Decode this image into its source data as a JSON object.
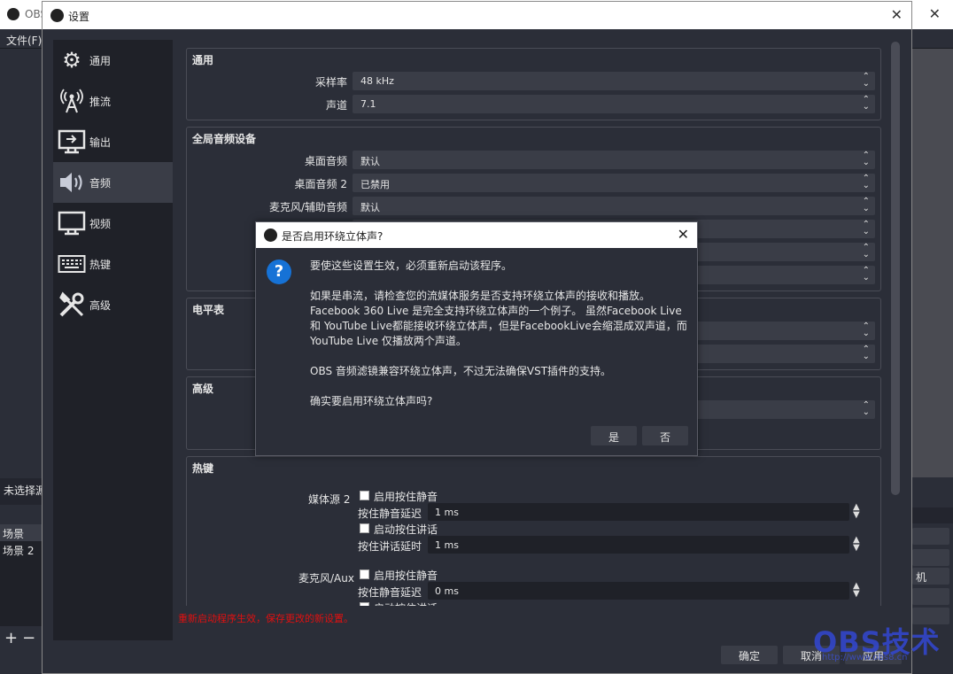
{
  "main_window": {
    "title": "OBS",
    "menu_file": "文件(F)",
    "scene_header": "未选择源",
    "scenes": [
      "场景",
      "场景 2"
    ],
    "add": "+",
    "remove": "−",
    "right_button": "机"
  },
  "settings": {
    "title": "设置",
    "nav": [
      {
        "label": "通用",
        "icon": "gear-icon"
      },
      {
        "label": "推流",
        "icon": "broadcast-icon"
      },
      {
        "label": "输出",
        "icon": "output-icon"
      },
      {
        "label": "音频",
        "icon": "speaker-icon"
      },
      {
        "label": "视频",
        "icon": "monitor-icon"
      },
      {
        "label": "热键",
        "icon": "keyboard-icon"
      },
      {
        "label": "高级",
        "icon": "tools-icon"
      }
    ],
    "active_nav": "音频",
    "general": {
      "title": "通用",
      "sample_rate_label": "采样率",
      "sample_rate_value": "48 kHz",
      "channels_label": "声道",
      "channels_value": "7.1"
    },
    "global_audio": {
      "title": "全局音频设备",
      "rows": [
        {
          "label": "桌面音频",
          "value": "默认"
        },
        {
          "label": "桌面音频 2",
          "value": "已禁用"
        },
        {
          "label": "麦克风/辅助音频",
          "value": "默认"
        }
      ]
    },
    "meters": {
      "title": "电平表"
    },
    "advanced": {
      "title": "高级"
    },
    "hotkeys": {
      "title": "热键",
      "media_source": "媒体源 2",
      "mic_aux": "麦克风/Aux",
      "enable_push_to_mute": "启用按住静音",
      "push_to_mute_delay": "按住静音延迟",
      "enable_push_to_talk": "启动按住讲话",
      "push_to_talk_delay": "按住讲话延时",
      "delay_1": "1  ms",
      "delay_2": "1  ms",
      "delay_3": "0  ms"
    },
    "warning": "重新启动程序生效，保存更改的新设置。",
    "buttons": {
      "ok": "确定",
      "cancel": "取消",
      "apply": "应用"
    }
  },
  "dialog": {
    "title": "是否启用环绕立体声?",
    "line1": "要使这些设置生效，必须重新启动该程序。",
    "line2": "如果是串流，请检查您的流媒体服务是否支持环绕立体声的接收和播放。",
    "line3": "Facebook 360 Live 是完全支持环绕立体声的一个例子。 虽然Facebook Live",
    "line4": "和 YouTube Live都能接收环绕立体声，但是FacebookLive会缩混成双声道，而",
    "line5": "YouTube Live 仅播放两个声道。",
    "line6": "OBS 音频滤镜兼容环绕立体声，不过无法确保VST插件的支持。",
    "line7": "确实要启用环绕立体声吗?",
    "yes": "是",
    "no": "否"
  },
  "watermark": {
    "text": "OBS技术",
    "sub": "http://www.obs8.cn"
  }
}
